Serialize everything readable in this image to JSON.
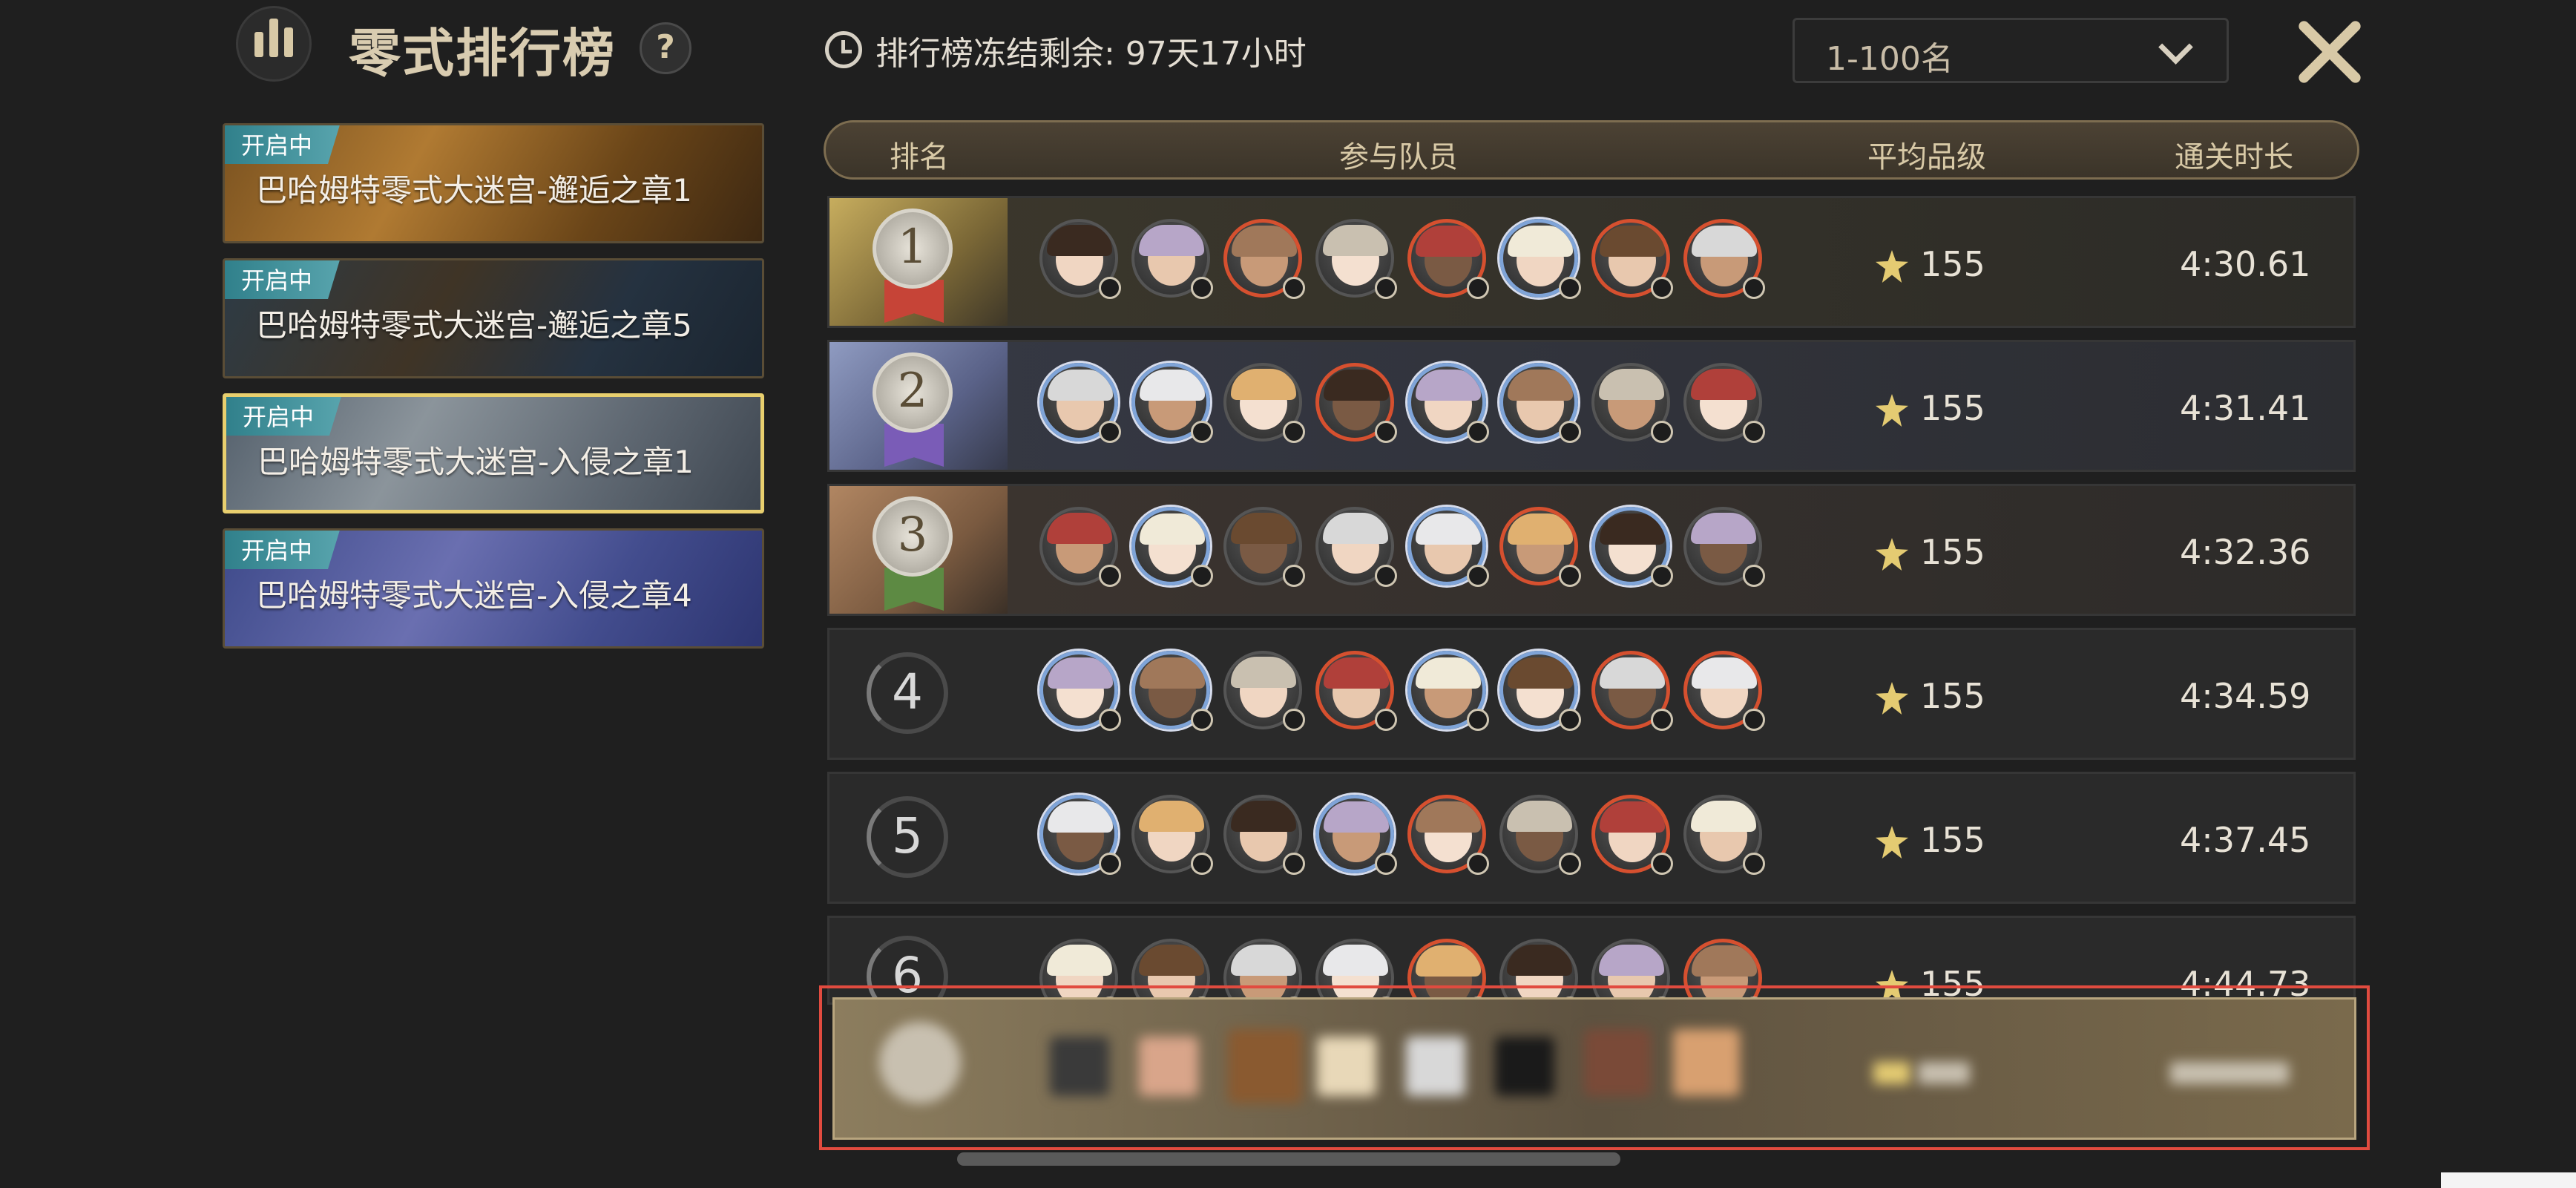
{
  "header": {
    "title": "零式排行榜",
    "help_label": "?",
    "freeze_text": "排行榜冻结剩余: 97天17小时",
    "range_select_value": "1-100名"
  },
  "stages": [
    {
      "tag": "开启中",
      "name": "巴哈姆特零式大迷宫-邂逅之章1",
      "selected": false
    },
    {
      "tag": "开启中",
      "name": "巴哈姆特零式大迷宫-邂逅之章5",
      "selected": false
    },
    {
      "tag": "开启中",
      "name": "巴哈姆特零式大迷宫-入侵之章1",
      "selected": true
    },
    {
      "tag": "开启中",
      "name": "巴哈姆特零式大迷宫-入侵之章4",
      "selected": false
    }
  ],
  "table": {
    "columns": {
      "rank": "排名",
      "members": "参与队员",
      "ilvl": "平均品级",
      "time": "通关时长"
    },
    "rows": [
      {
        "rank": "1",
        "ilvl": "155",
        "time": "4:30.61"
      },
      {
        "rank": "2",
        "ilvl": "155",
        "time": "4:31.41"
      },
      {
        "rank": "3",
        "ilvl": "155",
        "time": "4:32.36"
      },
      {
        "rank": "4",
        "ilvl": "155",
        "time": "4:34.59"
      },
      {
        "rank": "5",
        "ilvl": "155",
        "time": "4:37.45"
      },
      {
        "rank": "6",
        "ilvl": "155",
        "time": "4:44.73"
      }
    ]
  },
  "colors": {
    "accent_gold": "#d8c9a6",
    "tag_teal": "#2d7d88",
    "selected_border": "#e8cf6e",
    "own_row_highlight": "#e14b3f"
  },
  "icons": [
    "ranking-bars-icon",
    "help-icon",
    "clock-icon",
    "chevron-down-icon",
    "close-x-icon",
    "item-level-icon",
    "job-icon"
  ]
}
